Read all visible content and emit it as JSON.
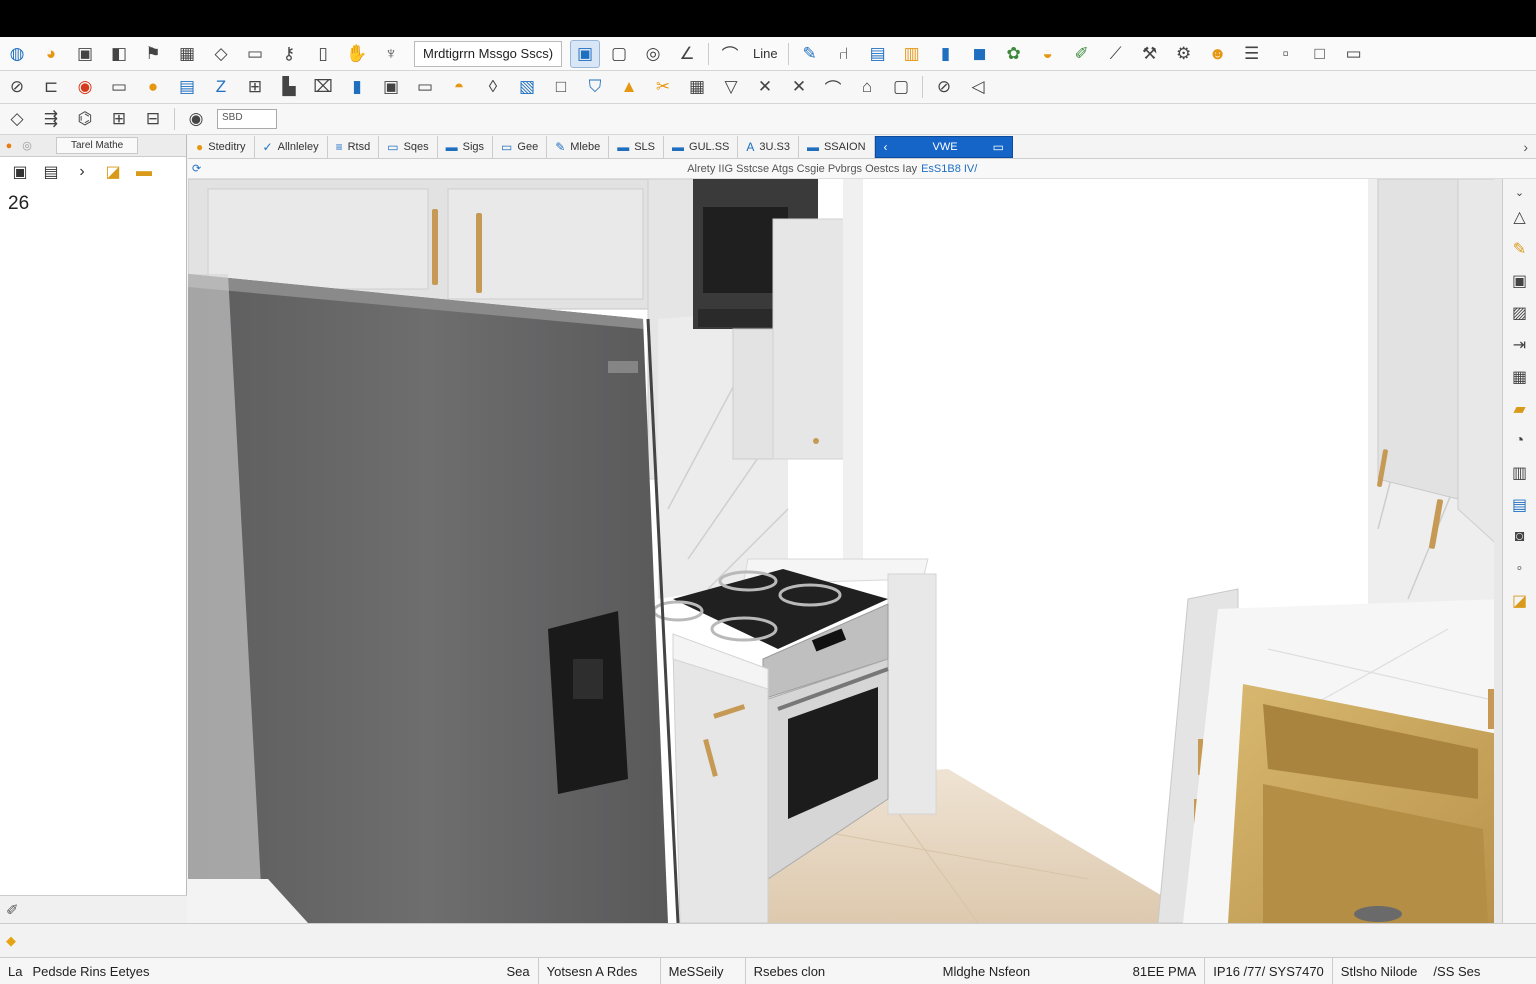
{
  "title_field": "Mrdtigrrn Mssgo Sscs)",
  "toolbar1": {
    "line_label": "Line"
  },
  "toolbar3": {
    "input_value": "SBD"
  },
  "left_panel": {
    "tab_label": "Tarel Mathe",
    "value": "26"
  },
  "view_tabs": [
    {
      "label": "Steditry"
    },
    {
      "label": "Allnleley"
    },
    {
      "label": "Rtsd"
    },
    {
      "label": "Sqes"
    },
    {
      "label": "Sigs"
    },
    {
      "label": "Gee"
    },
    {
      "label": "Mlebe"
    },
    {
      "label": "SLS"
    },
    {
      "label": "GUL.SS"
    },
    {
      "label": "3U.S3"
    },
    {
      "label": "SSAION"
    },
    {
      "label": "VWE"
    }
  ],
  "viewport_hint": {
    "text": "Alrety IIG Sstcse Atgs Csgie Pvbrgs Oestcs Iay",
    "target": "EsS1B8 IV/"
  },
  "status_bar": {
    "mode": "La",
    "message": "Pedsde Rins Eetyes",
    "segments": [
      "Sea",
      "Yotsesn A Rdes",
      "MeSSeily",
      "Rsebes clon",
      "Mldghe Nsfeon",
      "81EE PMA",
      "IP16 /77/ SYS7470",
      "Stlsho Nilode",
      "/SS Ses"
    ]
  },
  "colors": {
    "accent": "#1565c8",
    "brand_orange": "#e69712",
    "fridge": "#6a6a6b",
    "sink": "#c9a65a",
    "brass_handle": "#c69a55"
  }
}
